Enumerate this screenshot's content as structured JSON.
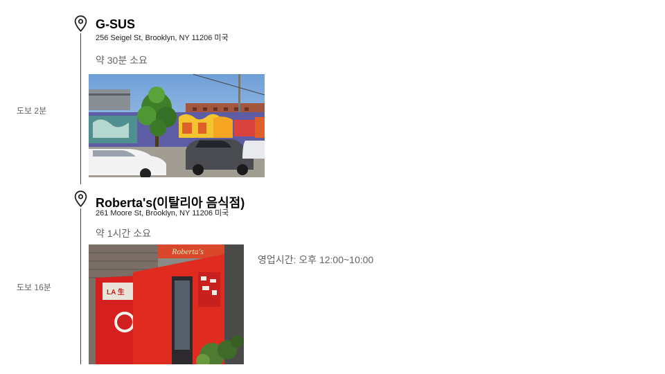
{
  "stops": [
    {
      "name": "G-SUS",
      "address": "256 Seigel St, Brooklyn, NY 11206 미국",
      "duration": "약 30분 소요",
      "walk": "도보 2분",
      "photo_icon": "street-graffiti-photo"
    },
    {
      "name": "Roberta's(이탈리아 음식점)",
      "address": "261 Moore St, Brooklyn, NY 11206 미국",
      "duration": "약 1시간 소요",
      "walk": "도보 16분",
      "hours": "영업시간: 오후 12:00~10:00",
      "photo_icon": "restaurant-entrance-photo"
    }
  ],
  "icons": {
    "pin": "location-pin-icon"
  },
  "colors": {
    "line": "#3c4043",
    "secondary_text": "#5f6368"
  }
}
